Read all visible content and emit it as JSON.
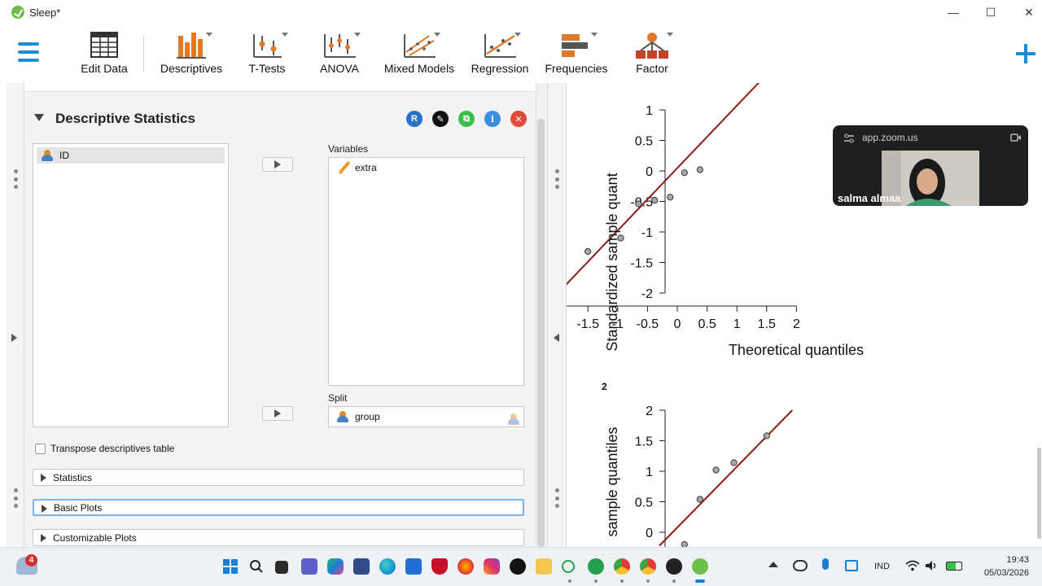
{
  "window": {
    "title": "Sleep*",
    "minimize_icon": "—",
    "maximize_icon": "☐",
    "close_icon": "✕"
  },
  "ribbon": {
    "items": [
      {
        "label": "Edit Data",
        "icon": "table-icon"
      },
      {
        "label": "Descriptives",
        "icon": "bar-chart-icon"
      },
      {
        "label": "T-Tests",
        "icon": "ttest-icon"
      },
      {
        "label": "ANOVA",
        "icon": "anova-icon"
      },
      {
        "label": "Mixed Models",
        "icon": "mixed-models-icon"
      },
      {
        "label": "Regression",
        "icon": "regression-icon"
      },
      {
        "label": "Frequencies",
        "icon": "frequencies-icon"
      },
      {
        "label": "Factor",
        "icon": "factor-icon"
      }
    ],
    "colors": {
      "accent": "#1a8cd8",
      "chart": "#e07a2a",
      "dark": "#555555"
    }
  },
  "panel": {
    "title": "Descriptive Statistics",
    "header_buttons": {
      "r": "R",
      "edit": "✎",
      "copy": "⧉",
      "info": "i",
      "close": "✕"
    },
    "available_variables": [
      "ID"
    ],
    "variables_label": "Variables",
    "variables": [
      "extra"
    ],
    "split_label": "Split",
    "split": [
      "group"
    ],
    "transpose_label": "Transpose descriptives table",
    "sections": [
      "Statistics",
      "Basic Plots",
      "Customizable Plots"
    ]
  },
  "results": {
    "plot1": {
      "ylabel": "Standardized sample quant",
      "xlabel": "Theoretical quantiles",
      "yticks": [
        "1",
        "0.5",
        "0",
        "-0.5",
        "-1",
        "-1.5",
        "-2"
      ],
      "xticks": [
        "-2",
        "-1.5",
        "-1",
        "-0.5",
        "0",
        "0.5",
        "1",
        "1.5",
        "2"
      ]
    },
    "plot2": {
      "heading": "2",
      "ylabel": "sample quantiles",
      "yticks": [
        "2",
        "1.5",
        "1",
        "0.5",
        "0"
      ]
    }
  },
  "chart_data": [
    {
      "type": "scatter",
      "title": "",
      "xlabel": "Theoretical quantiles",
      "ylabel": "Standardized sample quant",
      "xlim": [
        -2,
        2
      ],
      "ylim": [
        -2,
        1
      ],
      "points": [
        [
          -1.5,
          -1.32
        ],
        [
          -0.95,
          -1.1
        ],
        [
          -0.65,
          -0.54
        ],
        [
          -0.38,
          -0.48
        ],
        [
          -0.12,
          -0.43
        ],
        [
          0.12,
          -0.03
        ],
        [
          0.38,
          0.02
        ]
      ],
      "reference_line": [
        [
          -2,
          -2
        ],
        [
          1.42,
          1.5
        ]
      ]
    },
    {
      "type": "scatter",
      "title": "2",
      "xlabel": "",
      "ylabel": "sample quantiles",
      "xlim": [
        -2,
        2
      ],
      "ylim": [
        0,
        2
      ],
      "points": [
        [
          0.12,
          -0.2
        ],
        [
          0.38,
          0.54
        ],
        [
          0.65,
          1.02
        ],
        [
          0.95,
          1.14
        ],
        [
          1.5,
          1.58
        ]
      ],
      "reference_line": [
        [
          -0.3,
          -0.22
        ],
        [
          1.93,
          2.0
        ]
      ]
    }
  ],
  "zoom": {
    "url": "app.zoom.us",
    "participant": "salma almaa"
  },
  "taskbar": {
    "notification_count": "4",
    "language": "IND",
    "time": "19:43",
    "date": "05/03/2026"
  }
}
